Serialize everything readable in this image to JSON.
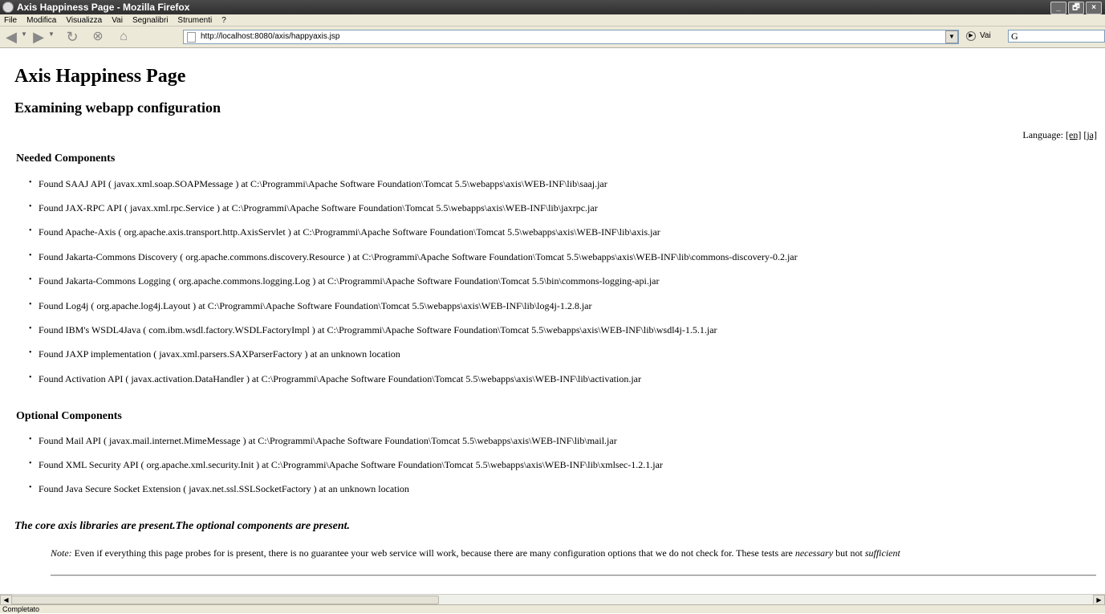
{
  "window": {
    "title": "Axis Happiness Page - Mozilla Firefox",
    "buttons": [
      "_",
      "🗗",
      "×"
    ]
  },
  "menu": [
    "File",
    "Modifica",
    "Visualizza",
    "Vai",
    "Segnalibri",
    "Strumenti",
    "?"
  ],
  "toolbar": {
    "url": "http://localhost:8080/axis/happyaxis.jsp",
    "go_label": "Vai",
    "search_value": "G",
    "icons": [
      "back-icon",
      "forward-icon",
      "reload-icon",
      "stop-icon",
      "home-icon"
    ]
  },
  "page": {
    "title": "Axis Happiness Page",
    "subtitle": "Examining webapp configuration",
    "language_label": "Language:",
    "languages": [
      "[en]",
      "[ja]"
    ],
    "needed_heading": "Needed Components",
    "needed": [
      "Found SAAJ API ( javax.xml.soap.SOAPMessage ) at C:\\Programmi\\Apache Software Foundation\\Tomcat 5.5\\webapps\\axis\\WEB-INF\\lib\\saaj.jar",
      "Found JAX-RPC API ( javax.xml.rpc.Service ) at C:\\Programmi\\Apache Software Foundation\\Tomcat 5.5\\webapps\\axis\\WEB-INF\\lib\\jaxrpc.jar",
      "Found Apache-Axis ( org.apache.axis.transport.http.AxisServlet ) at C:\\Programmi\\Apache Software Foundation\\Tomcat 5.5\\webapps\\axis\\WEB-INF\\lib\\axis.jar",
      "Found Jakarta-Commons Discovery ( org.apache.commons.discovery.Resource ) at C:\\Programmi\\Apache Software Foundation\\Tomcat 5.5\\webapps\\axis\\WEB-INF\\lib\\commons-discovery-0.2.jar",
      "Found Jakarta-Commons Logging ( org.apache.commons.logging.Log ) at C:\\Programmi\\Apache Software Foundation\\Tomcat 5.5\\bin\\commons-logging-api.jar",
      "Found Log4j ( org.apache.log4j.Layout ) at C:\\Programmi\\Apache Software Foundation\\Tomcat 5.5\\webapps\\axis\\WEB-INF\\lib\\log4j-1.2.8.jar",
      "Found IBM's WSDL4Java ( com.ibm.wsdl.factory.WSDLFactoryImpl ) at C:\\Programmi\\Apache Software Foundation\\Tomcat 5.5\\webapps\\axis\\WEB-INF\\lib\\wsdl4j-1.5.1.jar",
      "Found JAXP implementation ( javax.xml.parsers.SAXParserFactory ) at an unknown location",
      "Found Activation API ( javax.activation.DataHandler ) at C:\\Programmi\\Apache Software Foundation\\Tomcat 5.5\\webapps\\axis\\WEB-INF\\lib\\activation.jar"
    ],
    "optional_heading": "Optional Components",
    "optional": [
      "Found Mail API ( javax.mail.internet.MimeMessage ) at C:\\Programmi\\Apache Software Foundation\\Tomcat 5.5\\webapps\\axis\\WEB-INF\\lib\\mail.jar",
      "Found XML Security API ( org.apache.xml.security.Init ) at C:\\Programmi\\Apache Software Foundation\\Tomcat 5.5\\webapps\\axis\\WEB-INF\\lib\\xmlsec-1.2.1.jar",
      "Found Java Secure Socket Extension ( javax.net.ssl.SSLSocketFactory ) at an unknown location"
    ],
    "summary": "The core axis libraries are present.The optional components are present.",
    "note_label": "Note:",
    "note_text": " Even if everything this page probes for is present, there is no guarantee your web service will work, because there are many configuration options that we do not check for. These tests are ",
    "note_necessary": "necessary",
    "note_middle": " but not ",
    "note_sufficient": "sufficient"
  },
  "status": "Completato"
}
